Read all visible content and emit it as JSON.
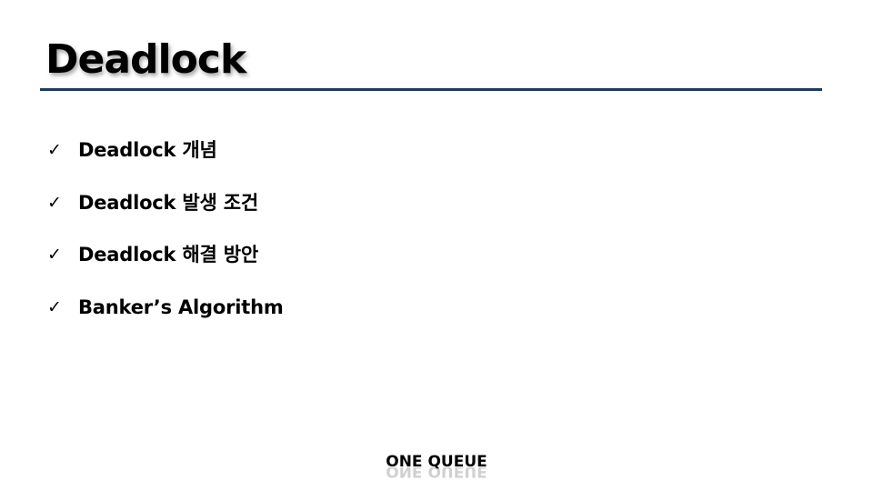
{
  "slide": {
    "title": "Deadlock",
    "items": [
      {
        "icon": "check-icon",
        "text": "Deadlock 개념"
      },
      {
        "icon": "check-icon",
        "text": "Deadlock 발생 조건"
      },
      {
        "icon": "check-icon",
        "text": "Deadlock 해결 방안"
      },
      {
        "icon": "check-icon",
        "text": "Banker’s Algorithm"
      }
    ]
  },
  "footer": {
    "logo_text": "ONE QUEUE"
  },
  "colors": {
    "title_rule": "#1f3864",
    "text": "#000000",
    "background": "#ffffff"
  }
}
